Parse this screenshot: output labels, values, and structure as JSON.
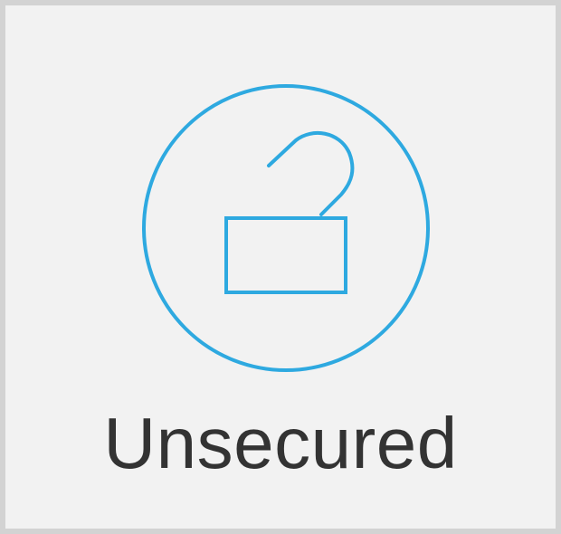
{
  "status": {
    "label": "Unsecured",
    "icon": "unlocked-padlock-icon",
    "state": "unsecured"
  },
  "colors": {
    "accent": "#2ea9e0",
    "text": "#333333",
    "background": "#f2f2f2",
    "border": "#d3d3d3"
  }
}
